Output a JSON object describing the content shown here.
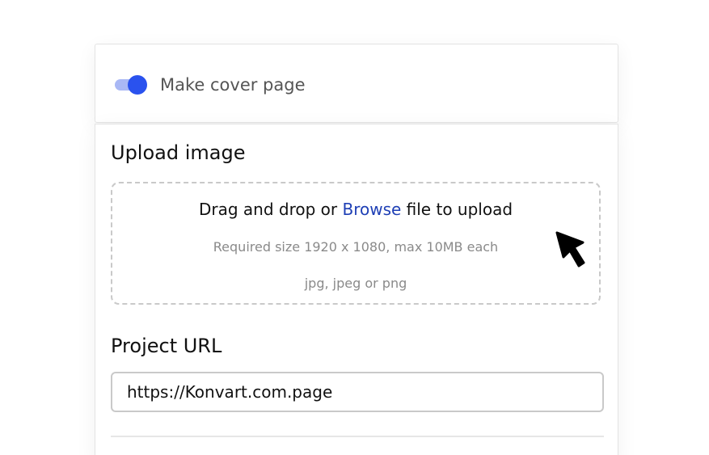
{
  "cover_page": {
    "toggle_on": true,
    "label": "Make cover page",
    "accent_color": "#2a52ee",
    "track_color": "#a9b8f5"
  },
  "upload": {
    "title": "Upload image",
    "drop_text_before": "Drag and drop or ",
    "browse_label": "Browse",
    "drop_text_after": " file to upload",
    "size_note": "Required size 1920 x 1080, max 10MB each",
    "formats_note": "jpg, jpeg or png",
    "link_color": "#1e3fb5"
  },
  "project_url": {
    "title": "Project URL",
    "value": "https://Konvart.com.page"
  },
  "icons": {
    "cursor": "mouse-pointer-icon"
  }
}
